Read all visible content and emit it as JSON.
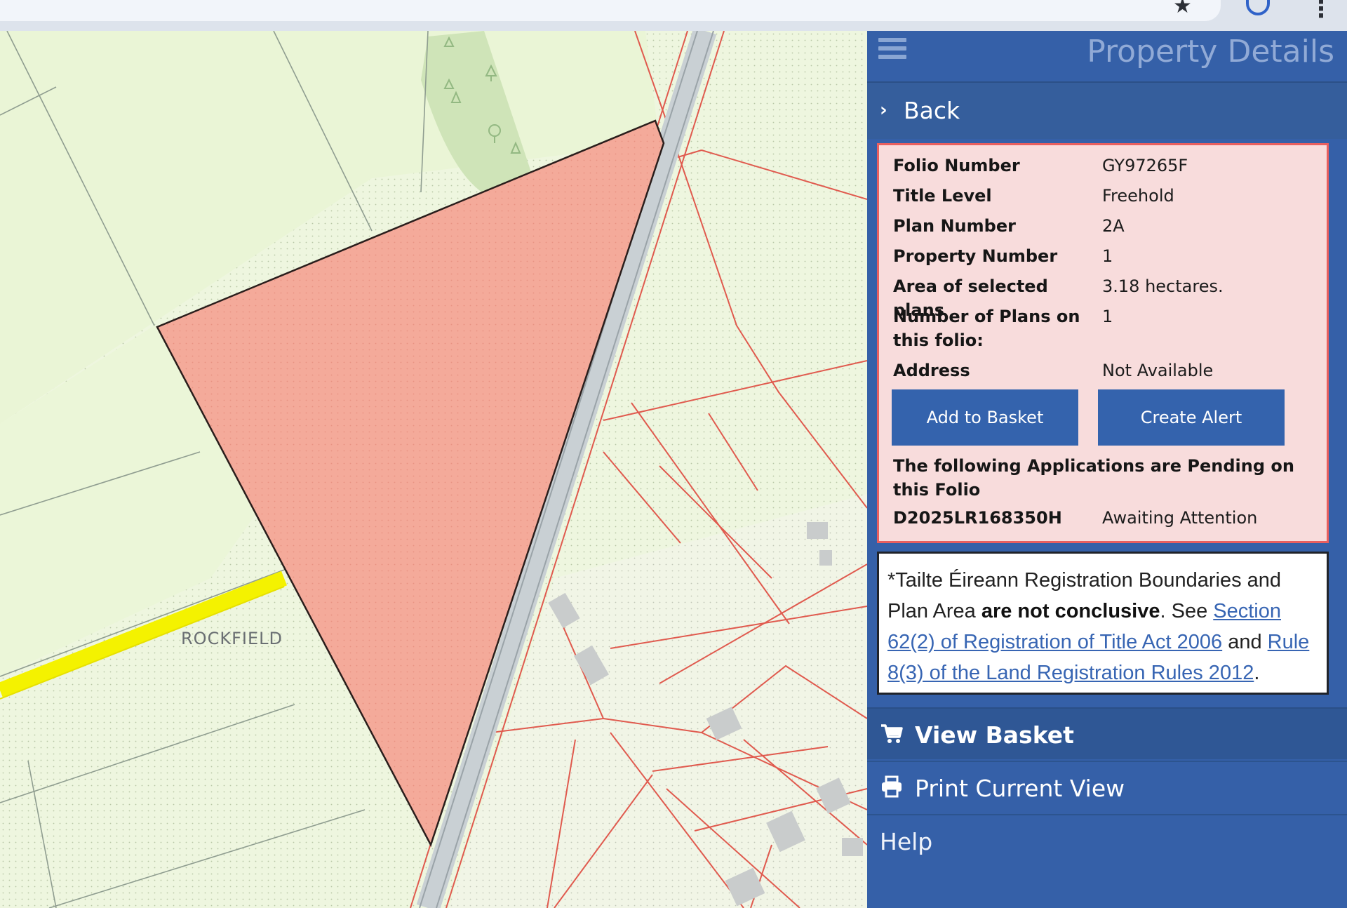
{
  "browser": {
    "star_glyph": "★",
    "more_glyph": "⋮"
  },
  "map": {
    "place_label": "ROCKFIELD",
    "colors": {
      "background": "#eef6df",
      "field": "#eaf5d6",
      "selected_parcel": "#f4aa9a",
      "boundary": "#e0584e",
      "road": "#f4f200",
      "rail": "#c9d0d4",
      "forest": "#cfe4b8"
    }
  },
  "panel": {
    "title": "Property Details",
    "back_label": "Back",
    "details": [
      {
        "label": "Folio Number",
        "value": "GY97265F"
      },
      {
        "label": "Title Level",
        "value": "Freehold"
      },
      {
        "label": "Plan Number",
        "value": "2A"
      },
      {
        "label": "Property Number",
        "value": "1"
      },
      {
        "label": "Area of selected plans",
        "value": "3.18 hectares."
      },
      {
        "label": "Number of Plans on this folio:",
        "value": "1"
      },
      {
        "label": "Address",
        "value": "Not Available"
      }
    ],
    "buttons": {
      "add_to_basket": "Add to Basket",
      "create_alert": "Create Alert"
    },
    "pending": {
      "heading": "The following Applications are Pending on this Folio",
      "application_id": "D2025LR168350H",
      "status": "Awaiting Attention"
    },
    "notice": {
      "prefix": " *Tailte Éireann Registration Boundaries and Plan Area ",
      "emphasis": "are not conclusive",
      "middle": ". See ",
      "link1": "Section 62(2) of Registration of Title Act 2006",
      "conjunction": " and ",
      "link2": "Rule 8(3) of the Land Registration Rules 2012",
      "suffix": "."
    },
    "menu": {
      "view_basket": "View Basket",
      "print_current_view": "Print Current View",
      "help": "Help"
    },
    "colors": {
      "panel_bg": "#3560a8",
      "details_bg": "#f8dcdc",
      "details_border": "#e85f5f",
      "button_bg": "#3463ad",
      "link": "#3765b3"
    }
  }
}
